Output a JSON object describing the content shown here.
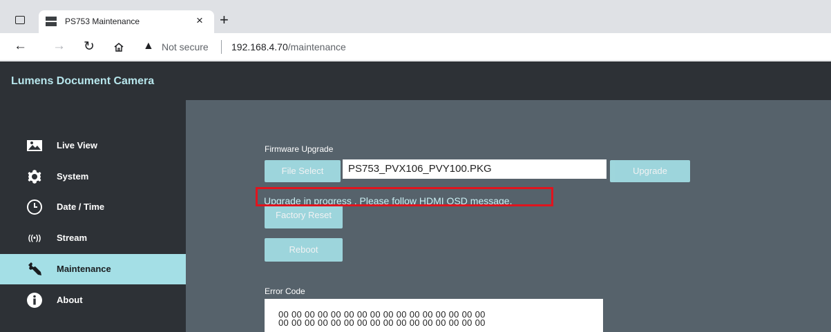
{
  "browser": {
    "tab_title": "PS753 Maintenance",
    "tab_close": "×",
    "new_tab": "+",
    "not_secure": "Not secure",
    "url_host": "192.168.4.70",
    "url_path": "/maintenance"
  },
  "app": {
    "title": "Lumens Document Camera"
  },
  "sidebar": {
    "items": [
      {
        "label": "Live View",
        "icon": "image-icon"
      },
      {
        "label": "System",
        "icon": "gear-icon"
      },
      {
        "label": "Date / Time",
        "icon": "clock-icon"
      },
      {
        "label": "Stream",
        "icon": "broadcast-icon"
      },
      {
        "label": "Maintenance",
        "icon": "wrench-icon",
        "active": true
      },
      {
        "label": "About",
        "icon": "info-icon"
      }
    ]
  },
  "maintenance": {
    "firmware_label": "Firmware Upgrade",
    "file_select_label": "File Select",
    "file_name": "PS753_PVX106_PVY100.PKG",
    "upgrade_label": "Upgrade",
    "status_message": "Upgrade in progress . Please follow HDMI OSD message.",
    "factory_reset_label": "Factory Reset",
    "reboot_label": "Reboot",
    "error_code_label": "Error Code",
    "error_rows": [
      "00 00 00 00 00 00 00 00 00 00 00 00 00 00 00 00",
      "00 00 00 00 00 00 00 00 00 00 00 00 00 00 00 00"
    ]
  },
  "colors": {
    "accent": "#a4dfe6",
    "app_bg": "#2d3136",
    "content_bg": "#56626b",
    "highlight": "#e0141e"
  }
}
